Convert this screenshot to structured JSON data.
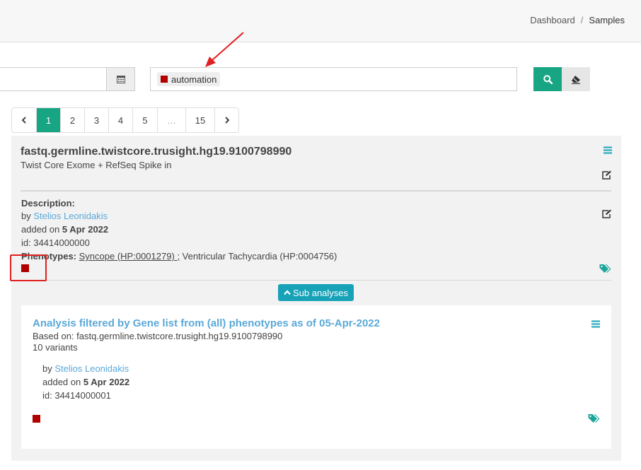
{
  "breadcrumb": {
    "home": "Dashboard",
    "separator": "/",
    "current": "Samples"
  },
  "search": {
    "date_icon": "calendar-icon",
    "filter_tag": {
      "label": "automation",
      "color": "#b00000"
    },
    "search_icon": "search-icon",
    "clear_icon": "eraser-icon"
  },
  "pagination": {
    "prev_icon": "chevron-left-icon",
    "pages": [
      "1",
      "2",
      "3",
      "4",
      "5",
      "…",
      "15"
    ],
    "active": "1",
    "next_icon": "chevron-right-icon"
  },
  "sample": {
    "title": "fastq.germline.twistcore.trusight.hg19.9100798990",
    "subtitle": "Twist Core Exome + RefSeq Spike in",
    "description_label": "Description:",
    "by_prefix": "by",
    "author": "Stelios Leonidakis",
    "added_prefix": "added on",
    "added_date": "5 Apr 2022",
    "id_text": "id: 34414000000",
    "phenotypes_label": "Phenotypes:",
    "phenotype_1": "Syncope (HP:0001279) ;",
    "phenotype_2": "Ventricular Tachycardia (HP:0004756)",
    "tag_color": "#b00000",
    "sub_analyses_label": "Sub analyses"
  },
  "analysis": {
    "title": "Analysis filtered by Gene list from (all) phenotypes as of 05-Apr-2022",
    "based_on": "Based on: fastq.germline.twistcore.trusight.hg19.9100798990",
    "variants": "10 variants",
    "by_prefix": "by",
    "author": "Stelios Leonidakis",
    "added_prefix": "added on",
    "added_date": "5 Apr 2022",
    "id_text": "id: 34414000001",
    "tag_color": "#b00000"
  },
  "colors": {
    "accent": "#17a583",
    "info": "#17a2b8",
    "link": "#5aa9d9",
    "tag_red": "#b00000",
    "annotation": "#e02020"
  }
}
